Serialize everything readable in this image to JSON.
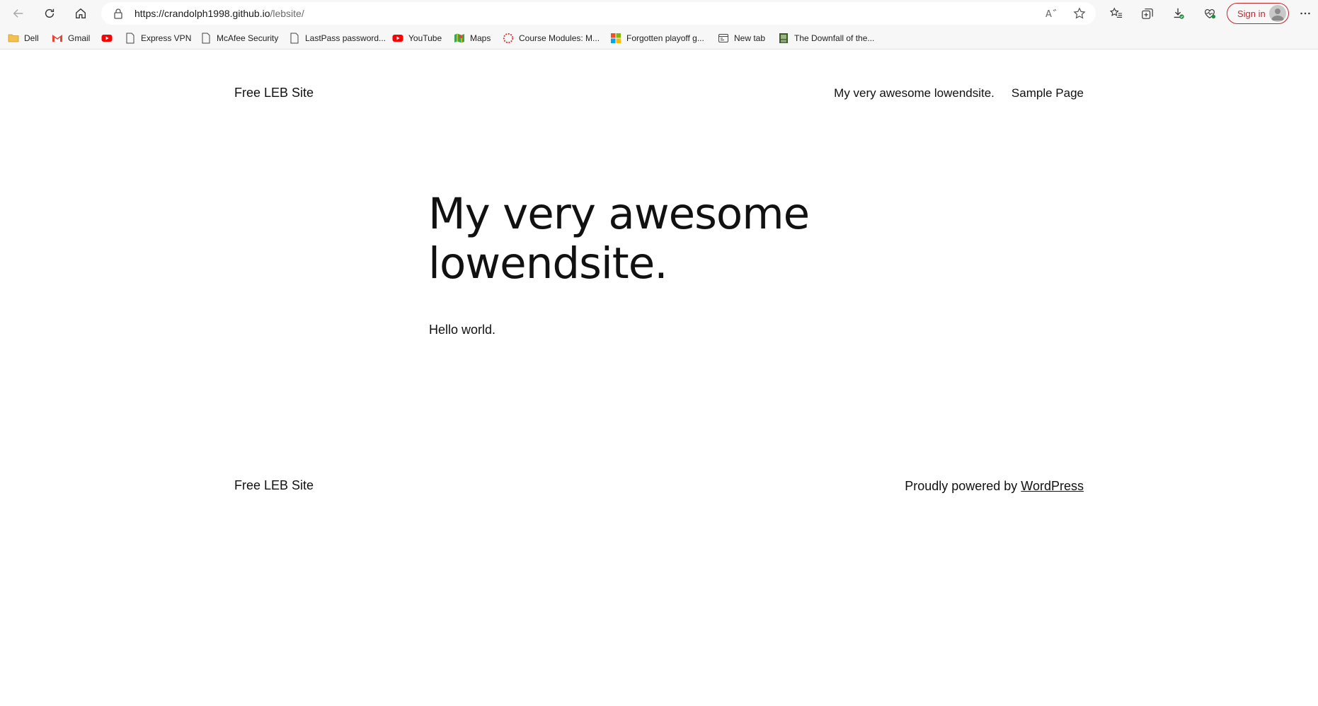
{
  "browser": {
    "url_host": "https://crandolph1998.github.io",
    "url_path": "/lebsite/",
    "sign_in_label": "Sign in",
    "bookmarks": [
      {
        "label": "Dell",
        "icon": "folder-icon"
      },
      {
        "label": "Gmail",
        "icon": "gmail-icon"
      },
      {
        "label": "",
        "icon": "youtube-icon"
      },
      {
        "label": "Express VPN",
        "icon": "page-icon"
      },
      {
        "label": "McAfee Security",
        "icon": "page-icon"
      },
      {
        "label": "LastPass password...",
        "icon": "page-icon"
      },
      {
        "label": "YouTube",
        "icon": "youtube-icon"
      },
      {
        "label": "Maps",
        "icon": "maps-icon"
      },
      {
        "label": "Course Modules: M...",
        "icon": "course-icon"
      },
      {
        "label": "Forgotten playoff g...",
        "icon": "microsoft-icon"
      },
      {
        "label": "New tab",
        "icon": "new-tab-icon"
      },
      {
        "label": "The Downfall of the...",
        "icon": "book-icon"
      }
    ]
  },
  "site": {
    "title": "Free LEB Site",
    "nav": [
      "My very awesome lowendsite.",
      "Sample Page"
    ]
  },
  "post": {
    "title": "My very awesome lowendsite.",
    "body": "Hello world."
  },
  "footer": {
    "title": "Free LEB Site",
    "credit_prefix": "Proudly powered by ",
    "credit_link": "WordPress"
  },
  "colors": {
    "chrome_bg": "#f7f7f7",
    "sign_in_accent": "#c4262e",
    "youtube_red": "#ff0000"
  }
}
